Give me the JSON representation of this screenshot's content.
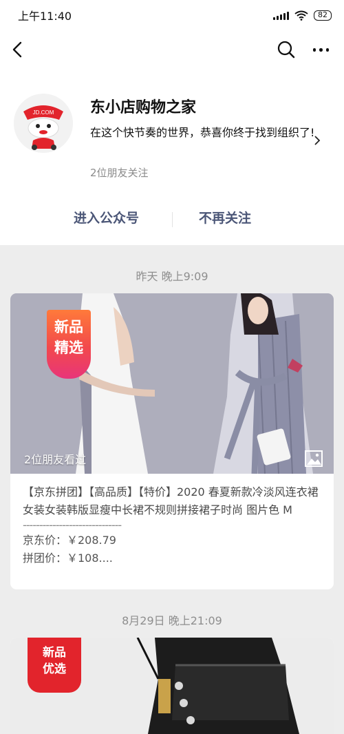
{
  "status": {
    "time": "上午11:40",
    "battery": "82"
  },
  "account": {
    "name": "东小店购物之家",
    "description": "在这个快节奏的世界，恭喜你终于找到组织了!",
    "followers": "2位朋友关注",
    "avatar_label": "JD.COM"
  },
  "actions": {
    "enter": "进入公众号",
    "unfollow": "不再关注"
  },
  "feed": [
    {
      "date": "昨天 晚上9:09",
      "badge_line1": "新品",
      "badge_line2": "精选",
      "friends_viewed": "2位朋友看过",
      "title": "【京东拼团】【高品质】【特价】2020 春夏新款冷淡风连衣裙女装女装韩版显瘦中长裙不规则拼接裙子时尚 图片色 M",
      "dash": "------------------------------",
      "price_jd": "京东价：￥208.79",
      "price_group": "拼团价：￥108...."
    },
    {
      "date": "8月29日 晚上21:09",
      "badge_line1": "新品",
      "badge_line2": "优选"
    }
  ],
  "colors": {
    "accent_link": "#4b5677",
    "badge_red": "#e2242c"
  }
}
